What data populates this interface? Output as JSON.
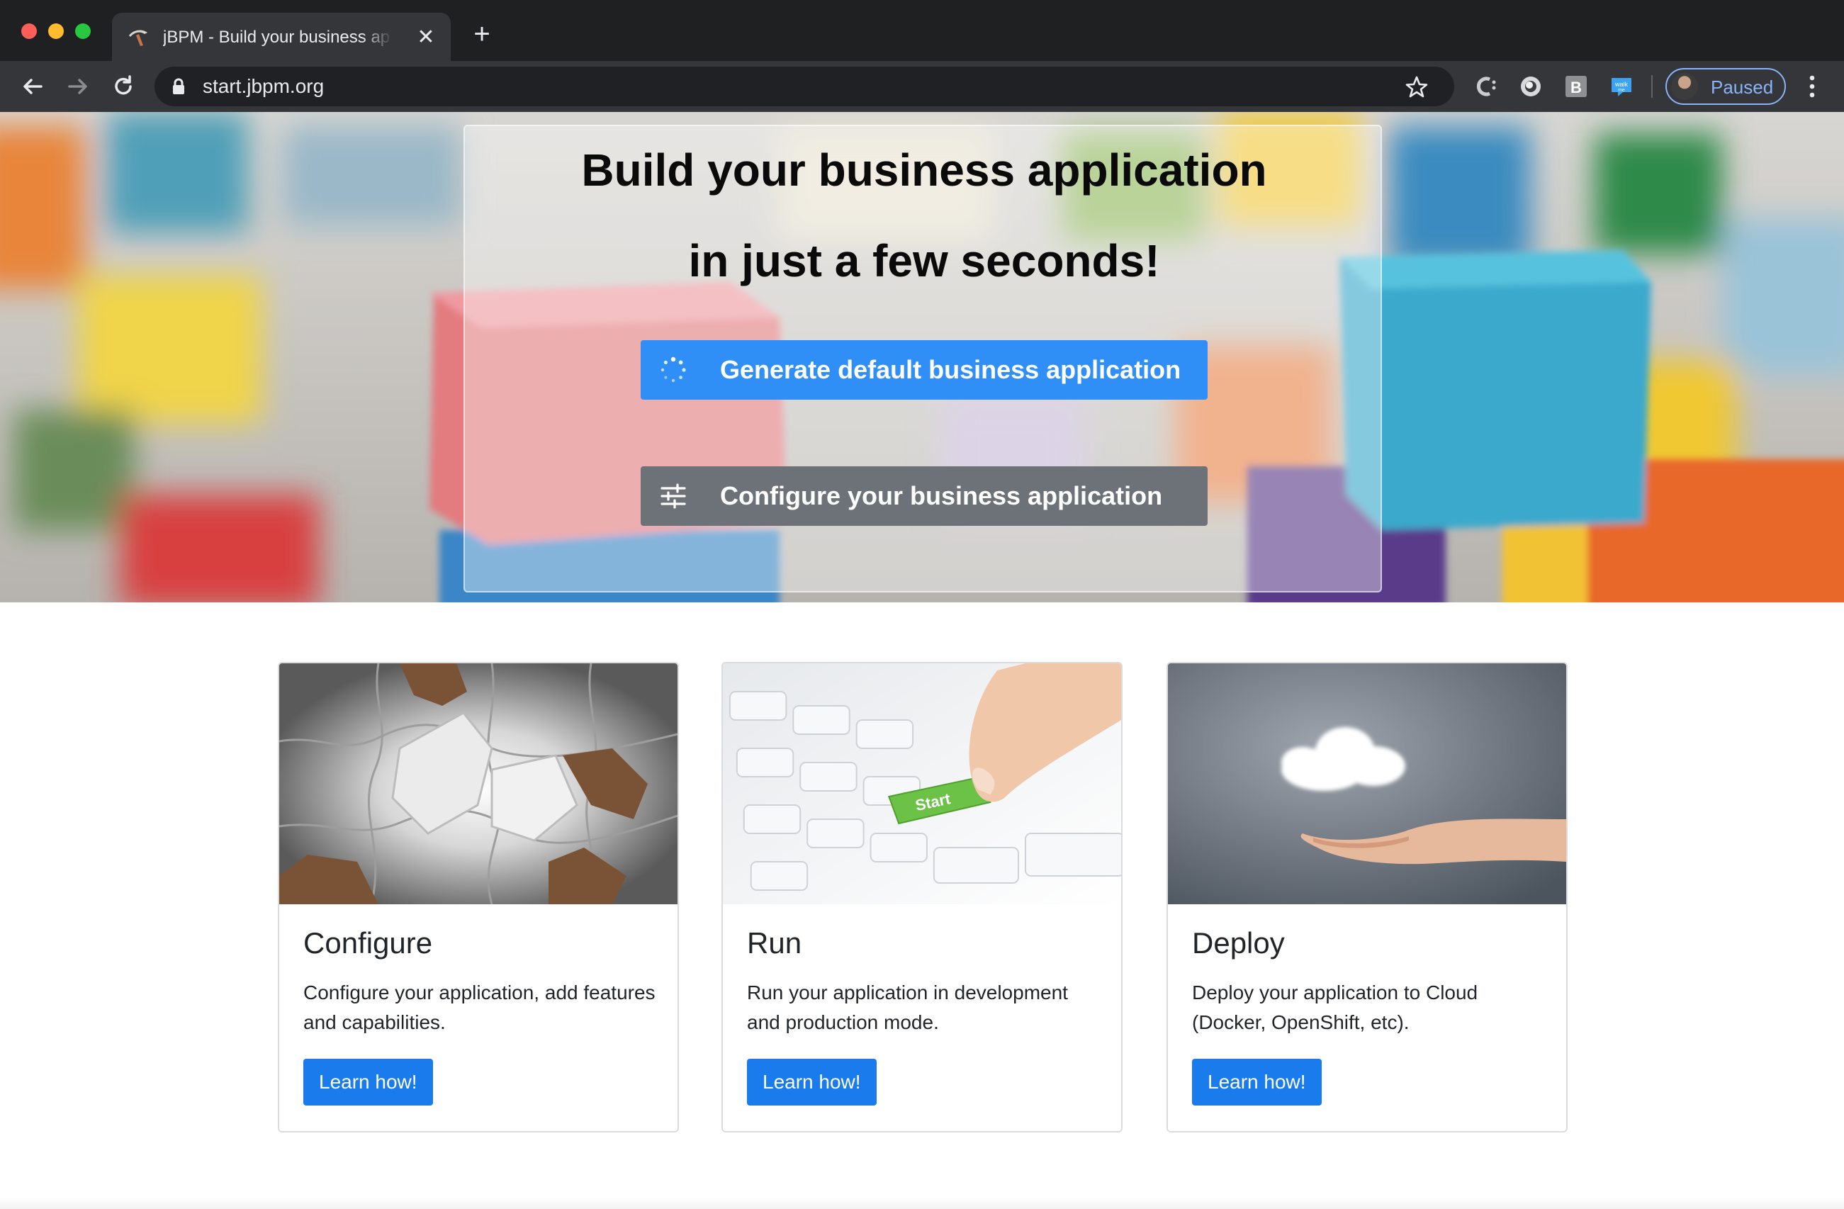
{
  "browser": {
    "tab_title": "jBPM - Build your business application",
    "new_tab_symbol": "+",
    "close_symbol": "✕",
    "url": "start.jbpm.org",
    "extensions": [
      "C",
      "●",
      "B",
      "walk me"
    ],
    "profile_label": "Paused",
    "accent_color": "#8ab4f8"
  },
  "hero": {
    "title_line1": "Build your business application",
    "title_line2": "in just a few seconds!",
    "generate_label": "Generate default business application",
    "configure_label": "Configure your business application",
    "generate_color": "#2f8ff7",
    "configure_color": "#6d7278"
  },
  "cards": [
    {
      "title": "Configure",
      "text": "Configure your application, add features and capabilities.",
      "button": "Learn how!",
      "image": "puzzle-pieces-image"
    },
    {
      "title": "Run",
      "text": "Run your application in development and production mode.",
      "button": "Learn how!",
      "image": "start-key-image"
    },
    {
      "title": "Deploy",
      "text": "Deploy your application to Cloud (Docker, OpenShift, etc).",
      "button": "Learn how!",
      "image": "cloud-in-hand-image"
    }
  ]
}
